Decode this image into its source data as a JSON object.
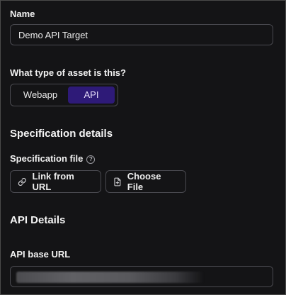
{
  "name_field": {
    "label": "Name",
    "value": "Demo API Target"
  },
  "asset_type": {
    "label": "What type of asset is this?",
    "options": [
      "Webapp",
      "API"
    ],
    "selected": "API"
  },
  "spec": {
    "heading": "Specification details",
    "file_label": "Specification file",
    "link_button": "Link from URL",
    "choose_button": "Choose File"
  },
  "api_details": {
    "heading": "API Details",
    "base_url_label": "API base URL"
  },
  "colors": {
    "accent": "#2e1a78",
    "background": "#141416",
    "border": "#4a4a50"
  }
}
